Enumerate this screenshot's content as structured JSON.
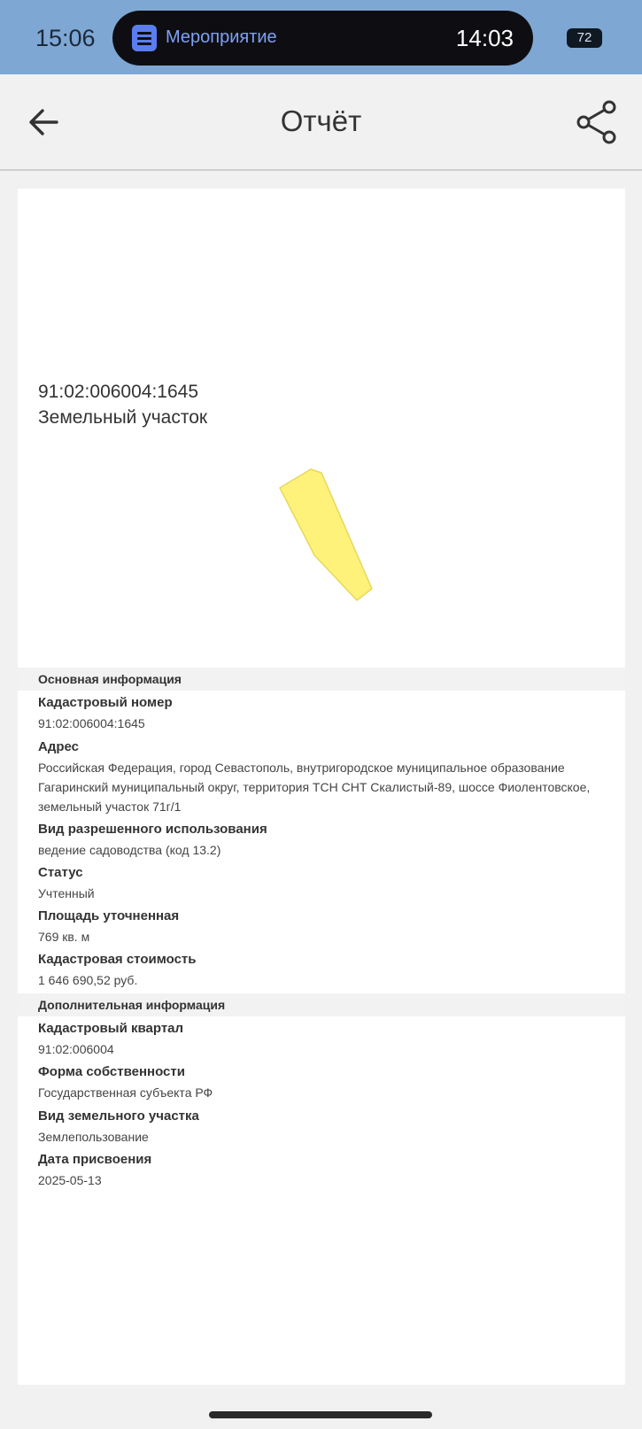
{
  "status_bar": {
    "time": "15:06",
    "activity_title": "Мероприятие",
    "activity_time": "14:03",
    "battery": "72"
  },
  "app_bar": {
    "title": "Отчёт",
    "back_icon": "arrow-left-icon",
    "share_icon": "share-icon"
  },
  "map": {
    "cadastral_number": "91:02:006004:1645",
    "object_type": "Земельный участок",
    "parcel_color": "#fff27a"
  },
  "main_info": {
    "header": "Основная информация",
    "fields": [
      {
        "label": "Кадастровый номер",
        "value": "91:02:006004:1645"
      },
      {
        "label": "Адрес",
        "value": "Российская Федерация, город Севастополь, внутригородское муниципальное образование Гагаринский муниципальный округ, территория ТСН СНТ Скалистый-89, шоссе Фиолентовское, земельный участок 71г/1"
      },
      {
        "label": "Вид разрешенного использования",
        "value": "ведение садоводства (код 13.2)"
      },
      {
        "label": "Статус",
        "value": "Учтенный"
      },
      {
        "label": "Площадь уточненная",
        "value": "769 кв. м"
      },
      {
        "label": "Кадастровая стоимость",
        "value": "1 646 690,52 руб."
      }
    ]
  },
  "extra_info": {
    "header": "Дополнительная информация",
    "fields": [
      {
        "label": "Кадастровый квартал",
        "value": "91:02:006004"
      },
      {
        "label": "Форма собственности",
        "value": "Государственная субъекта РФ"
      },
      {
        "label": "Вид земельного участка",
        "value": "Землепользование"
      },
      {
        "label": "Дата присвоения",
        "value": "2025-05-13"
      }
    ]
  },
  "colors": {
    "status_bar": "#7ea7d3",
    "pill_accent": "#5a7ef0"
  }
}
